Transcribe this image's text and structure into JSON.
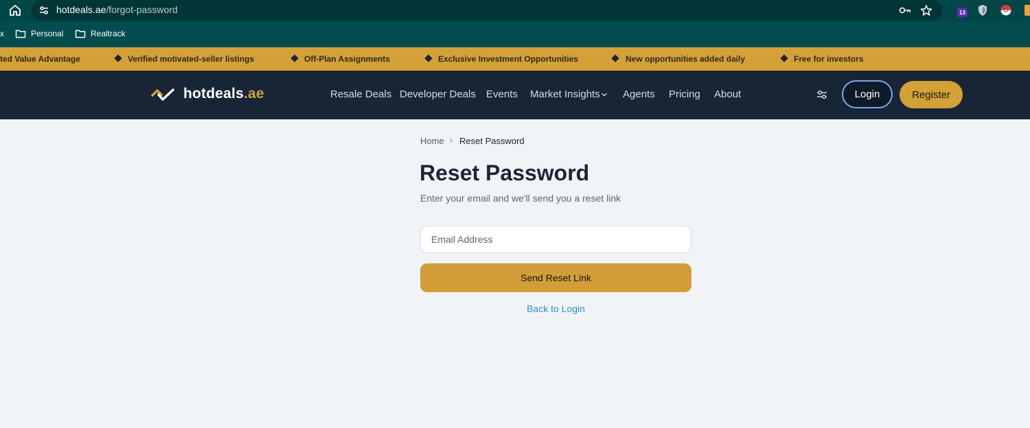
{
  "browser": {
    "url_domain": "hotdeals.ae",
    "url_path": "/forgot-password",
    "extension_badge": "13",
    "icons": [
      "home-icon",
      "site-settings-icon",
      "password-key-icon",
      "bookmark-star-icon"
    ]
  },
  "bookmarks": [
    {
      "label": "x"
    },
    {
      "label": "Personal",
      "icon": "folder-icon"
    },
    {
      "label": "Realtrack",
      "icon": "folder-icon"
    }
  ],
  "ticker": [
    "ted Value Advantage",
    "Verified motivated-seller listings",
    "Off-Plan Assignments",
    "Exclusive Investment Opportunities",
    "New opportunities added daily",
    "Free for investors"
  ],
  "nav": {
    "logo_main": "hotdeals",
    "logo_tld": ".ae",
    "links": [
      "Resale Deals",
      "Developer Deals",
      "Events",
      "Market Insights",
      "Agents",
      "Pricing",
      "About"
    ],
    "login": "Login",
    "register": "Register"
  },
  "breadcrumb": {
    "home": "Home",
    "current": "Reset Password"
  },
  "form": {
    "title": "Reset Password",
    "subtitle": "Enter your email and we'll send you a reset link",
    "email_placeholder": "Email Address",
    "submit": "Send Reset Link",
    "back": "Back to Login"
  },
  "colors": {
    "accent": "#d4a038",
    "nav_bg": "#182537",
    "browser_bg": "#024648",
    "page_bg": "#f1f4f7",
    "link": "#2d8ec9"
  }
}
